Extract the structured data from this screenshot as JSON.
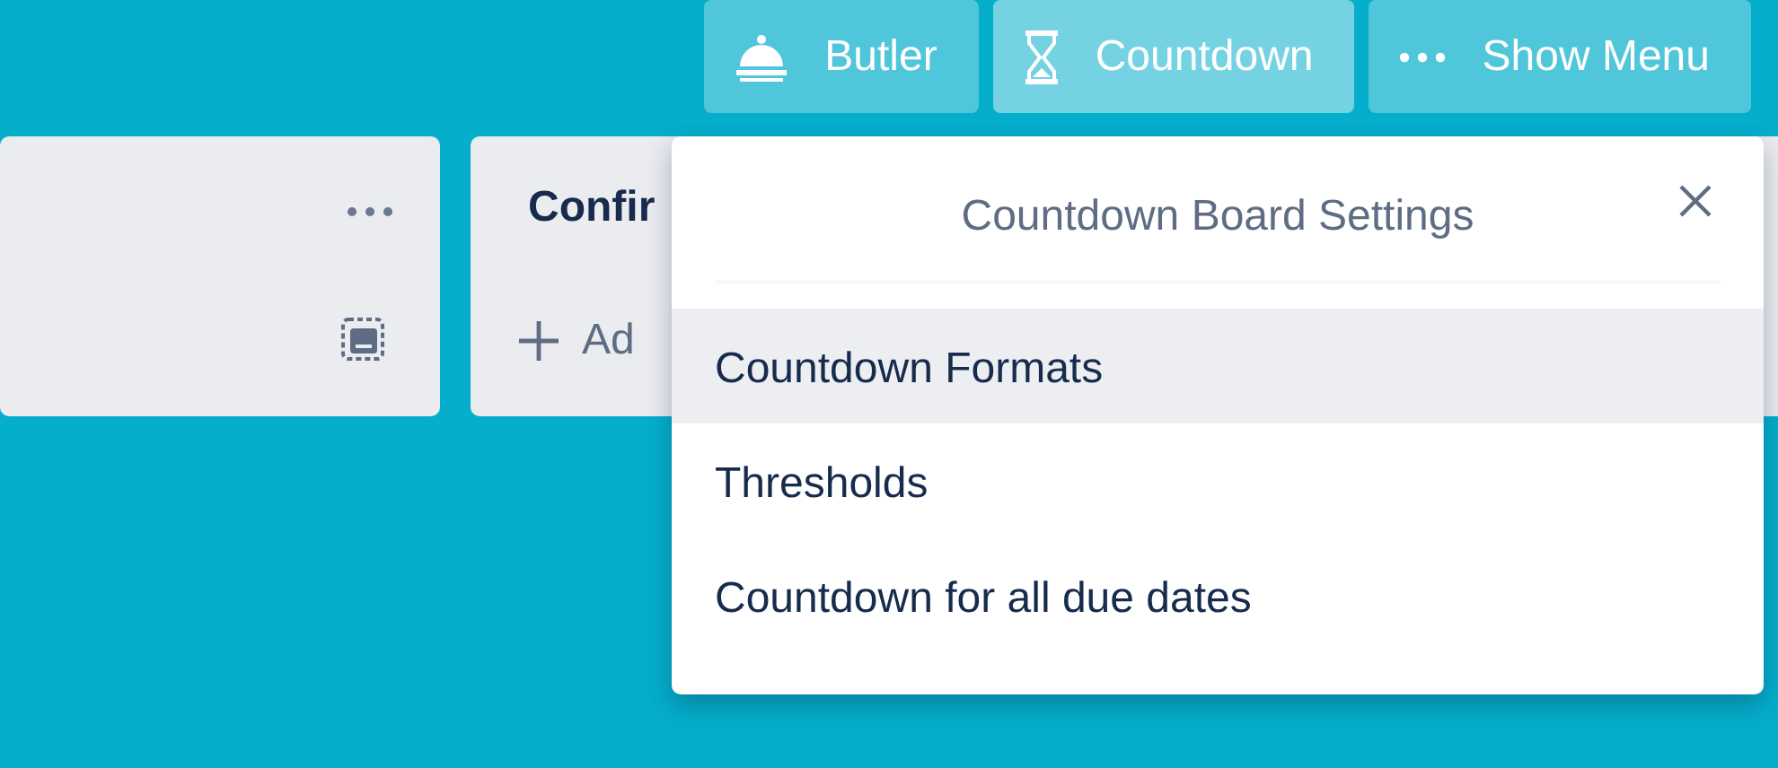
{
  "header_buttons": [
    {
      "label": "Butler",
      "kind": "bell",
      "selected": false
    },
    {
      "label": "Countdown",
      "kind": "hourglass",
      "selected": true
    },
    {
      "label": "Show Menu",
      "kind": "dots",
      "selected": false
    }
  ],
  "lists": [
    {
      "kind": "untitled"
    },
    {
      "kind": "titled",
      "title": "Confir",
      "add_label": "Ad"
    },
    {
      "kind": "edge"
    }
  ],
  "popup": {
    "title": "Countdown Board Settings",
    "items": [
      {
        "label": "Countdown Formats",
        "selected": true
      },
      {
        "label": "Thresholds",
        "selected": false
      },
      {
        "label": "Countdown for all due dates",
        "selected": false
      }
    ]
  }
}
